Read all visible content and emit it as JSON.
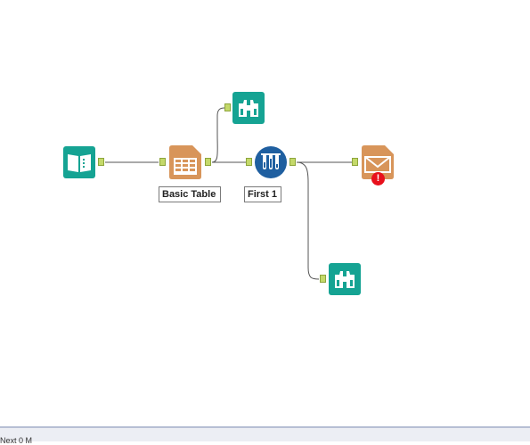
{
  "canvas": {
    "tools": [
      {
        "id": "input",
        "icon": "book-icon",
        "label": ""
      },
      {
        "id": "table",
        "icon": "table-icon",
        "label": "Basic Table"
      },
      {
        "id": "browse_top",
        "icon": "binoculars-icon",
        "label": ""
      },
      {
        "id": "sample",
        "icon": "test-tubes-icon",
        "label": "First 1"
      },
      {
        "id": "email",
        "icon": "envelope-icon",
        "label": "",
        "error": true
      },
      {
        "id": "browse_bottom",
        "icon": "binoculars-icon",
        "label": ""
      }
    ]
  },
  "colors": {
    "teal": "#15a393",
    "orange": "#d8955a",
    "blue": "#1f5fa0",
    "port": "#c4d96a",
    "error": "#e8101c",
    "statusbar": "#eceef4"
  },
  "statusbar": {
    "text": "Next 0      M"
  }
}
